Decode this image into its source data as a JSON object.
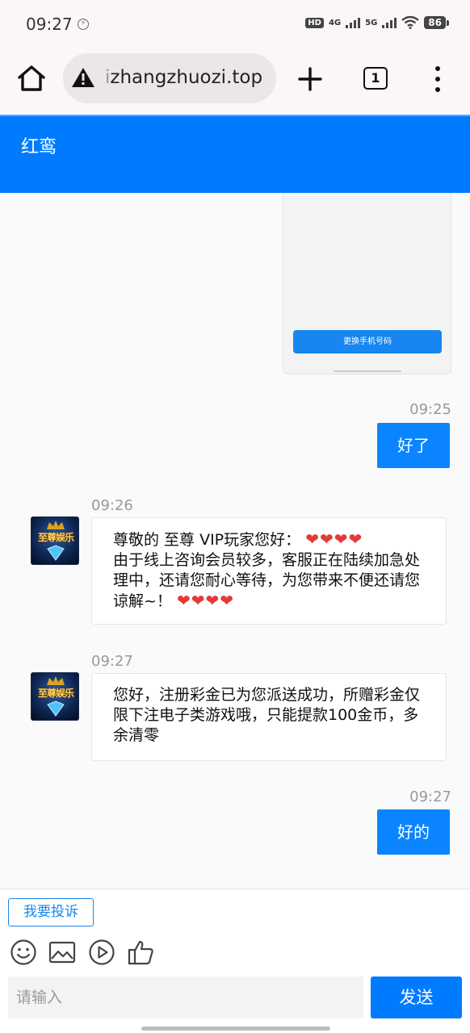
{
  "status_bar": {
    "time": "09:27",
    "network_1": "4G",
    "network_2": "5G",
    "hd_label": "HD",
    "battery": "86"
  },
  "browser": {
    "url_prefix": "i",
    "url_main": "zhangzhuozi.top",
    "tab_count": "1"
  },
  "app": {
    "title": "红鸾"
  },
  "chat": {
    "previous_card_button": "更换手机号码",
    "messages": [
      {
        "time": "09:25",
        "text": "好了"
      },
      {
        "time": "09:26",
        "avatar_label": "至尊娱乐",
        "line1_text": "尊敬的 至尊 VIP玩家您好：",
        "line1_hearts": "❤❤❤❤",
        "body": "由于线上咨询会员较多，客服正在陆续加急处理中，还请您耐心等待，为您带来不便还请您谅解~！",
        "tail_hearts": "❤❤❤❤"
      },
      {
        "time": "09:27",
        "avatar_label": "至尊娱乐",
        "text": "您好，注册彩金已为您派送成功，所赠彩金仅限下注电子类游戏哦，只能提款100金币，多余清零"
      },
      {
        "time": "09:27",
        "text": "好的"
      }
    ]
  },
  "input_area": {
    "complain_label": "我要投诉",
    "placeholder": "请输入",
    "send_label": "发送",
    "tools": [
      "emoji-icon",
      "image-icon",
      "play-icon",
      "thumbs-up-icon"
    ]
  },
  "colors": {
    "accent": "#007bff",
    "bubble_out": "#0a84ff",
    "heart": "#e53935"
  }
}
